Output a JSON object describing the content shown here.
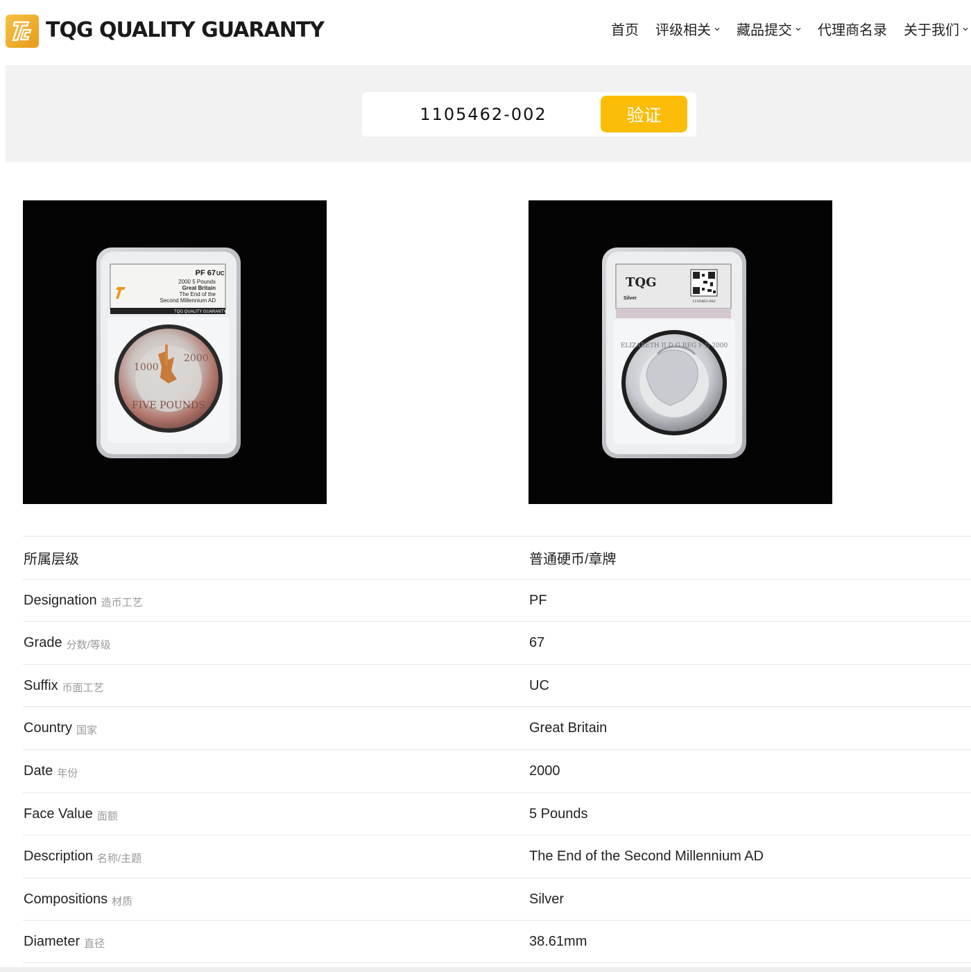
{
  "header": {
    "brand": "TQG QUALITY GUARANTY",
    "nav": [
      {
        "label": "首页",
        "has_dropdown": false
      },
      {
        "label": "评级相关",
        "has_dropdown": true
      },
      {
        "label": "藏品提交",
        "has_dropdown": true
      },
      {
        "label": "代理商名录",
        "has_dropdown": false
      },
      {
        "label": "关于我们",
        "has_dropdown": true
      }
    ]
  },
  "search": {
    "value": "1105462-002",
    "button_label": "验证"
  },
  "photos": {
    "front_slab": {
      "grade": "PF 67",
      "suffix": "UC",
      "line1": "2000    5 Pounds",
      "line2": "Great Britain",
      "line3": "The End of the",
      "line4": "Second Millennium AD",
      "footer": "TQG QUALITY GUARANTY",
      "coin_text_top": "1000",
      "coin_text_right": "2000",
      "coin_text_bottom": "FIVE POUNDS"
    },
    "back_slab": {
      "logo_text": "TQG",
      "material": "Silver",
      "cert": "1105462-002",
      "coin_text": "ELIZABETH II D G REG F D 2000"
    }
  },
  "details": {
    "category": {
      "label": "所属层级",
      "value": "普通硬币/章牌"
    },
    "rows": [
      {
        "label": "Designation",
        "sub": "造币工艺",
        "value": "PF"
      },
      {
        "label": "Grade",
        "sub": "分数/等级",
        "value": "67"
      },
      {
        "label": "Suffix",
        "sub": "币面工艺",
        "value": "UC"
      },
      {
        "label": "Country",
        "sub": "国家",
        "value": "Great Britain"
      },
      {
        "label": "Date",
        "sub": "年份",
        "value": "2000"
      },
      {
        "label": "Face Value",
        "sub": "面额",
        "value": "5 Pounds"
      },
      {
        "label": "Description",
        "sub": "名称/主题",
        "value": "The End of the Second Millennium AD"
      },
      {
        "label": "Compositions",
        "sub": "材质",
        "value": "Silver"
      },
      {
        "label": "Diameter",
        "sub": "直径",
        "value": "38.61mm"
      }
    ]
  },
  "colors": {
    "accent": "#fbbd08",
    "band": "#f2f2f2",
    "logo": "#f0b030"
  }
}
